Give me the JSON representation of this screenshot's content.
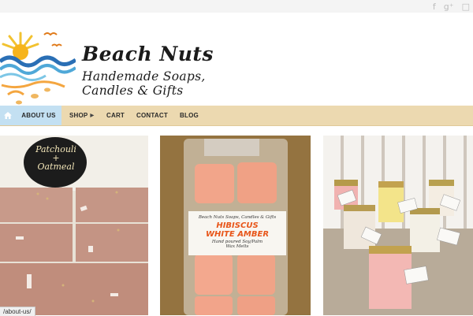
{
  "social": {
    "facebook": "f",
    "googleplus": "g⁺",
    "extra": "□"
  },
  "brand": {
    "title": "Beach Nuts",
    "subtitle_line1": "Handemade Soaps,",
    "subtitle_line2": "Candles & Gifts"
  },
  "nav": {
    "items": [
      {
        "label": "ABOUT US"
      },
      {
        "label": "SHOP"
      },
      {
        "label": "CART"
      },
      {
        "label": "CONTACT"
      },
      {
        "label": "BLOG"
      }
    ]
  },
  "tiles": {
    "soap_sign_line1": "Patchouli",
    "soap_sign_line2": "+",
    "soap_sign_line3": "Oatmeal",
    "melt_label_line1": "Beach Nuts Soaps, Candles & Gifts",
    "melt_label_line2": "HIBISCUS",
    "melt_label_line3": "WHITE AMBER",
    "melt_label_line4": "Hand poured Soy/Palm",
    "melt_label_line5": "Wax Melts"
  },
  "status": {
    "url": "/about-us/"
  },
  "colors": {
    "nav_bg": "#ecd9b0",
    "nav_active": "#c3e0f2"
  }
}
